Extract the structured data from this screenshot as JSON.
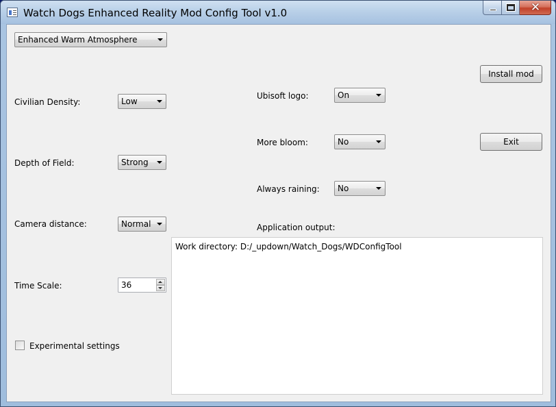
{
  "window": {
    "title": "Watch Dogs Enhanced Reality Mod Config Tool v1.0",
    "close_glyph": "✕"
  },
  "preset": {
    "selected": "Enhanced Warm Atmosphere"
  },
  "settings": {
    "civilian_density": {
      "label": "Civilian Density:",
      "value": "Low"
    },
    "depth_of_field": {
      "label": "Depth of Field:",
      "value": "Strong"
    },
    "camera_distance": {
      "label": "Camera distance:",
      "value": "Normal"
    },
    "time_scale": {
      "label": "Time Scale:",
      "value": "36"
    },
    "experimental": {
      "label": "Experimental settings",
      "checked": false
    },
    "ubisoft_logo": {
      "label": "Ubisoft logo:",
      "value": "On"
    },
    "more_bloom": {
      "label": "More bloom:",
      "value": "No"
    },
    "always_raining": {
      "label": "Always raining:",
      "value": "No"
    }
  },
  "buttons": {
    "install": "Install mod",
    "exit": "Exit"
  },
  "output": {
    "label": "Application output:",
    "lines": [
      "Work directory: D:/_updown/Watch_Dogs/WDConfigTool"
    ]
  },
  "icons": {
    "app": "app-window-icon",
    "minimize": "minimize-icon",
    "maximize": "maximize-icon",
    "close": "close-icon",
    "dropdown": "chevron-down-icon",
    "spin_up": "arrow-up-icon",
    "spin_down": "arrow-down-icon"
  }
}
